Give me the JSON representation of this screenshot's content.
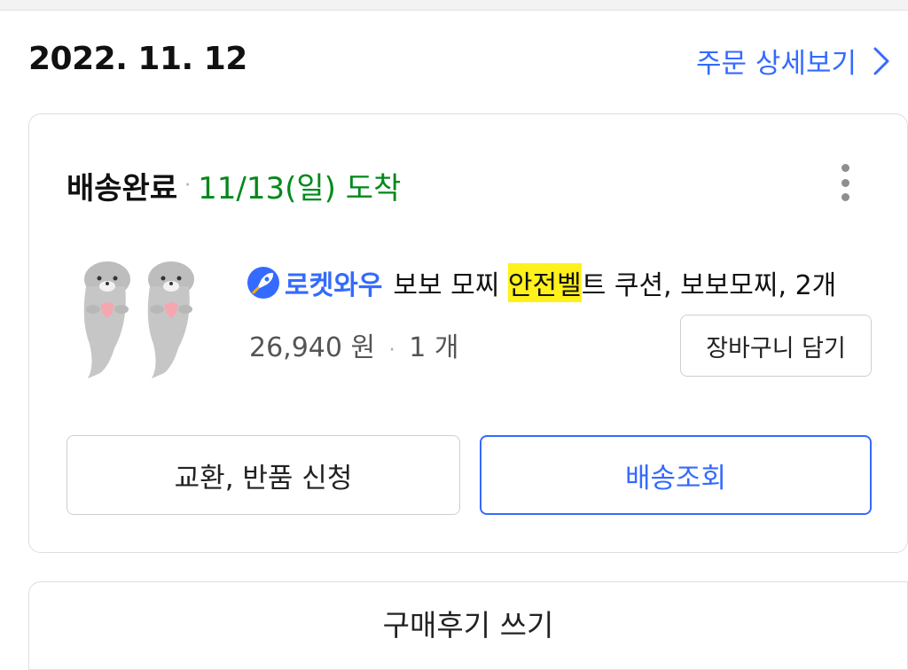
{
  "order": {
    "date": "2022. 11. 12",
    "detail_link": "주문 상세보기"
  },
  "delivery": {
    "status": "배송완료",
    "arrival": "11/13(일) 도착"
  },
  "product": {
    "badge": "로켓와우",
    "title_before": "보보 모찌 ",
    "title_highlight": "안전벨",
    "title_after": "트 쿠션, 보보모찌, 2개",
    "price": "26,940 원",
    "quantity": "1 개",
    "image_alt": "seal plush pair"
  },
  "buttons": {
    "cart": "장바구니 담기",
    "exchange": "교환, 반품 신청",
    "track": "배송조회",
    "review": "구매후기 쓰기"
  },
  "colors": {
    "accent": "#346aff",
    "arrival_green": "#00891a",
    "highlight": "#fff11b"
  },
  "icons": [
    "chevron-right-icon",
    "more-vertical-icon",
    "rocket-icon"
  ]
}
